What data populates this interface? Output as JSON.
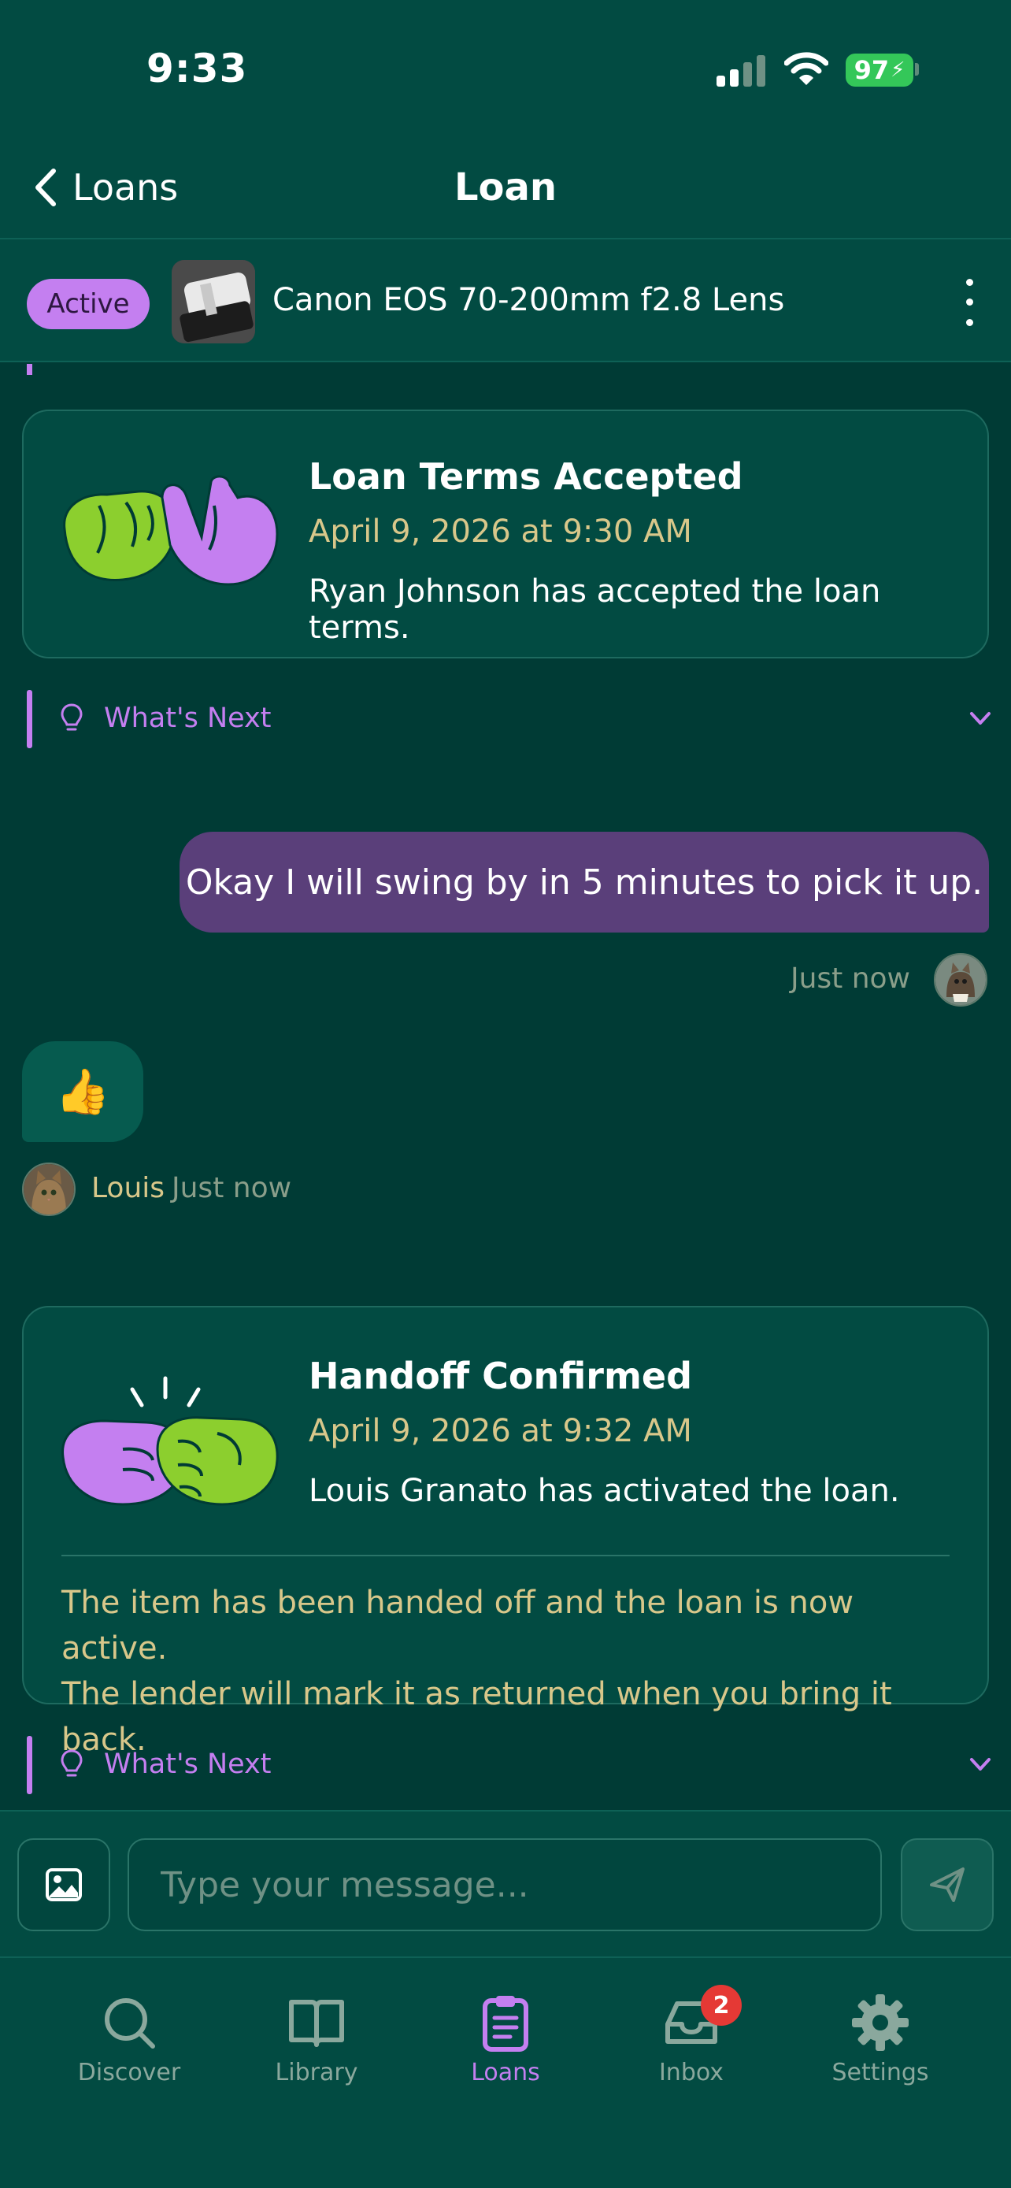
{
  "status_bar": {
    "time": "9:33",
    "battery": "97"
  },
  "nav": {
    "back_label": "Loans",
    "title": "Loan"
  },
  "item": {
    "status": "Active",
    "title": "Canon EOS 70-200mm f2.8 Lens"
  },
  "events": [
    {
      "title": "Loan Terms Accepted",
      "date": "April 9, 2026 at 9:30 AM",
      "description": "Ryan Johnson has accepted the loan terms."
    },
    {
      "title": "Handoff Confirmed",
      "date": "April 9, 2026 at 9:32 AM",
      "description": "Louis Granato has activated the loan.",
      "note_line1": "The item has been handed off and the loan is now active.",
      "note_line2": "The lender will mark it as returned when you bring it back."
    }
  ],
  "whats_next_label": "What's Next",
  "messages": [
    {
      "direction": "outgoing",
      "text": "Okay I will swing by in 5 minutes to pick it up.",
      "time": "Just now"
    },
    {
      "direction": "incoming",
      "text": "👍",
      "sender": "Louis",
      "time": "Just now"
    }
  ],
  "compose": {
    "placeholder": "Type your message..."
  },
  "tabs": [
    {
      "label": "Discover",
      "icon": "search-icon"
    },
    {
      "label": "Library",
      "icon": "book-icon"
    },
    {
      "label": "Loans",
      "icon": "clipboard-icon",
      "active": true
    },
    {
      "label": "Inbox",
      "icon": "inbox-icon",
      "badge": "2"
    },
    {
      "label": "Settings",
      "icon": "gear-icon"
    }
  ],
  "colors": {
    "background": "#003b35",
    "surface": "#024b42",
    "accent_purple": "#c47ff0",
    "outgoing_bubble": "#5a3f7a",
    "date_gold": "#d8c78a",
    "lime": "#8ccf2e"
  }
}
